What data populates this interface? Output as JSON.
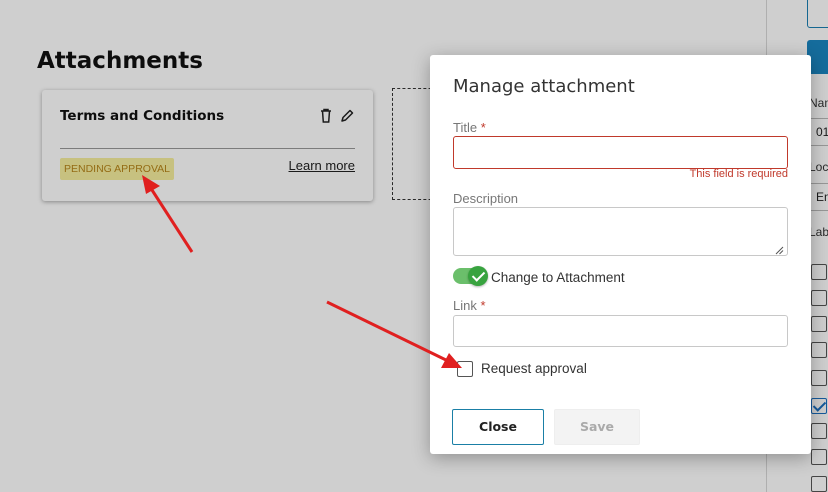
{
  "page": {
    "title": "Attachments",
    "card": {
      "title": "Terms and Conditions",
      "status_badge": "PENDING APPROVAL",
      "learn_more": "Learn more",
      "delete_icon": "trash-icon",
      "edit_icon": "pencil-icon"
    }
  },
  "right_panel": {
    "labels": [
      "Nam",
      "Loca",
      "Labe"
    ],
    "inputs": [
      "01",
      "Em"
    ],
    "checkboxes": [
      false,
      false,
      false,
      false,
      false,
      false,
      true,
      false,
      false,
      false
    ]
  },
  "modal": {
    "title": "Manage attachment",
    "title_field": {
      "label": "Title",
      "required_mark": "*",
      "value": "",
      "error": "This field is required"
    },
    "description_field": {
      "label": "Description",
      "value": ""
    },
    "toggle": {
      "label": "Change to Attachment",
      "on": true
    },
    "link_field": {
      "label": "Link",
      "required_mark": "*",
      "value": ""
    },
    "request_approval": {
      "label": "Request approval",
      "checked": false
    },
    "buttons": {
      "close": "Close",
      "save": "Save"
    }
  },
  "colors": {
    "accent": "#1a7fa6",
    "error": "#c0392b",
    "toggle_on": "#38a33f",
    "badge_bg": "#f5ee9e",
    "badge_text": "#b7861a",
    "annotation_arrow": "#e02020"
  }
}
